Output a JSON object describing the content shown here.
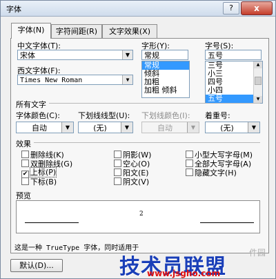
{
  "window": {
    "title": "字体",
    "help": "?",
    "close": "x"
  },
  "tabs": [
    {
      "label": "字体(N)",
      "active": true
    },
    {
      "label": "字符间距(R)",
      "active": false
    },
    {
      "label": "文字效果(X)",
      "active": false
    }
  ],
  "font": {
    "cn_label": "中文字体(T):",
    "cn_value": "宋体",
    "west_label": "西文字体(F):",
    "west_value": "Times New Roman",
    "style_label": "字形(Y):",
    "style_value": "常规",
    "style_list": [
      "常规",
      "倾斜",
      "加粗",
      "加粗 倾斜"
    ],
    "size_label": "字号(S):",
    "size_value": "五号",
    "size_list": [
      "三号",
      "小三",
      "四号",
      "小四",
      "五号"
    ]
  },
  "all_text": {
    "title": "所有文字",
    "color_label": "字体颜色(C):",
    "color_value": "自动",
    "underline_label": "下划线线型(U):",
    "underline_value": "(无)",
    "underline_color_label": "下划线颜色(I):",
    "underline_color_value": "自动",
    "emphasis_label": "着重号:",
    "emphasis_value": "(无)"
  },
  "effects": {
    "title": "效果",
    "items": [
      {
        "label": "删除线(K)",
        "checked": false
      },
      {
        "label": "双删除线(G)",
        "checked": false
      },
      {
        "label": "上标(P)",
        "checked": true
      },
      {
        "label": "下标(B)",
        "checked": false
      },
      {
        "label": "阴影(W)",
        "checked": false
      },
      {
        "label": "空心(O)",
        "checked": false
      },
      {
        "label": "阳文(E)",
        "checked": false
      },
      {
        "label": "阴文(V)",
        "checked": false
      },
      {
        "label": "小型大写字母(M)",
        "checked": false
      },
      {
        "label": "全部大写字母(A)",
        "checked": false
      },
      {
        "label": "隐藏文字(H)",
        "checked": false
      }
    ]
  },
  "preview": {
    "title": "预览",
    "sample": "2"
  },
  "footer": {
    "note": "这是一种 TrueType 字体，同时适用于",
    "default_button": "默认(D)..."
  },
  "watermark": {
    "text": "技术员联盟",
    "url": "www.jsgho.com",
    "corner": "件园"
  }
}
